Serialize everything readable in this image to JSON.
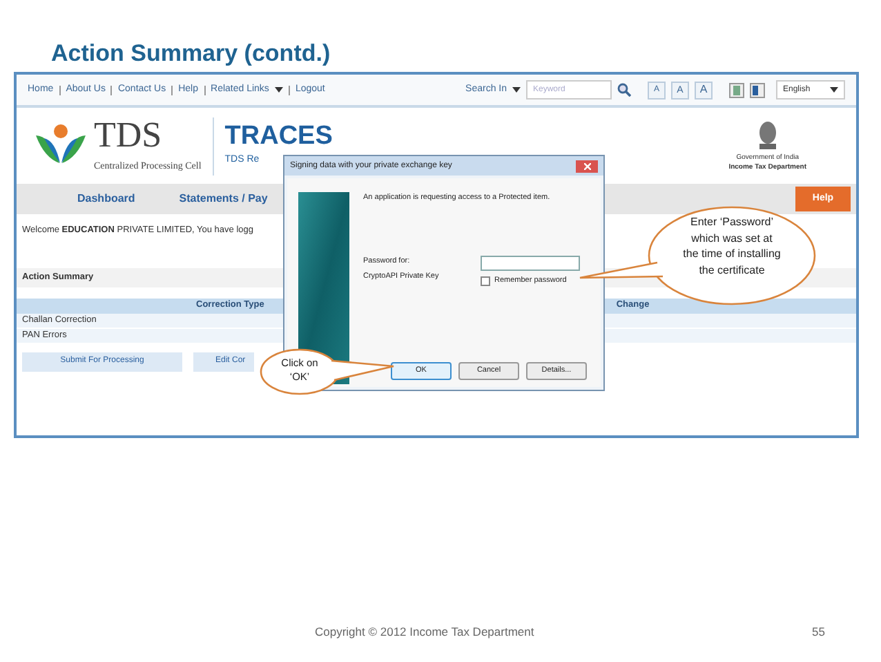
{
  "title": "Action Summary (contd.)",
  "screenshot": {
    "top_links": [
      "Home",
      "About Us",
      "Contact Us",
      "Help",
      "Related Links",
      "Logout"
    ],
    "search": {
      "label": "Search In",
      "placeholder": "Keyword"
    },
    "font_size_buttons": [
      "A",
      "A",
      "A"
    ],
    "language": "English",
    "header": {
      "logo_text": "TDS",
      "logo_subtitle": "Centralized Processing Cell",
      "app_name": "TRACES",
      "app_subtitle": "TDS Re",
      "emblem_lines": [
        "Government of India",
        "Income Tax Department"
      ]
    },
    "nav": [
      "Dashboard",
      "Statements / Pay"
    ],
    "help": "Help",
    "welcome": "Welcome **EDUCATION** PRIVATE LIMITED, You have logg",
    "section_title": "Action Summary",
    "table": {
      "columns": [
        "Correction Type",
        "Change"
      ],
      "rows": [
        "Challan Correction",
        "PAN Errors"
      ]
    },
    "buttons": [
      "Submit For Processing",
      "Edit Cor"
    ],
    "dialog": {
      "title": "Signing data with your private exchange key",
      "message": "An application is requesting access to a Protected item.",
      "password_label": "Password for:",
      "key_name": "CryptoAPI Private Key",
      "remember": {
        "label": "Remember password",
        "checked": false
      },
      "buttons": [
        {
          "label": "OK",
          "default": true
        },
        {
          "label": "Cancel",
          "default": false
        },
        {
          "label": "Details...",
          "default": false
        }
      ]
    }
  },
  "callouts": [
    "Enter ‘Password’ which was set at the time of installing the certificate",
    "Click on ‘OK’"
  ],
  "footer": {
    "copyright": "Copyright © 2012 Income Tax Department",
    "page": "55"
  }
}
